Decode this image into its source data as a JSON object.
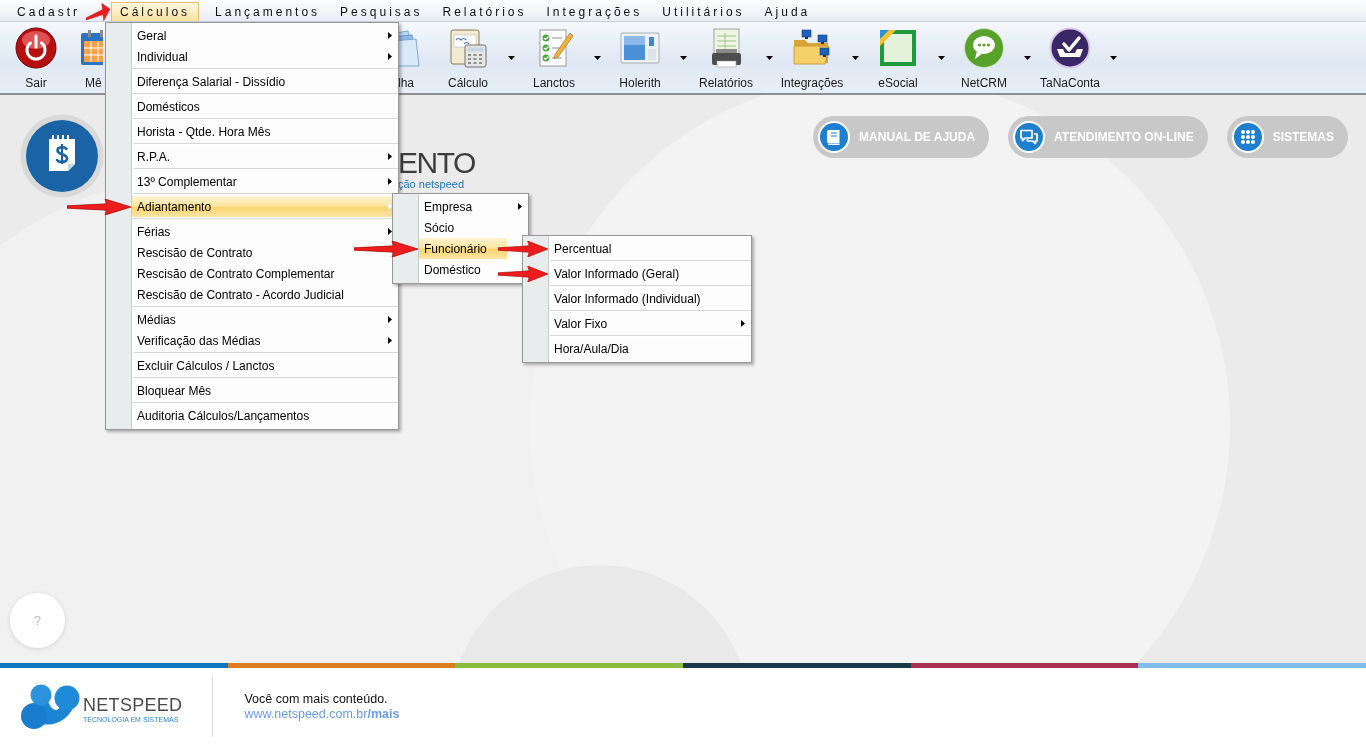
{
  "menu_bar": {
    "items": [
      {
        "label": "Cadastr",
        "selected": false,
        "pointed_at": false
      },
      {
        "label": "Cálculos",
        "selected": true,
        "pointed_at": true,
        "menu": {
          "sections": [
            [
              {
                "label": "Geral",
                "has_arrow": true,
                "selected": false,
                "pointed_at": false
              },
              {
                "label": "Individual",
                "has_arrow": true,
                "selected": false,
                "pointed_at": false
              }
            ],
            [
              {
                "label": "Diferença Salarial - Dissídio",
                "has_arrow": false,
                "selected": false,
                "pointed_at": false
              }
            ],
            [
              {
                "label": "Domésticos",
                "has_arrow": false,
                "selected": false,
                "pointed_at": false
              }
            ],
            [
              {
                "label": "Horista - Qtde. Hora Mês",
                "has_arrow": false,
                "selected": false,
                "pointed_at": false
              }
            ],
            [
              {
                "label": "R.P.A.",
                "has_arrow": true,
                "selected": false,
                "pointed_at": false
              }
            ],
            [
              {
                "label": "13º Complementar",
                "has_arrow": true,
                "selected": false,
                "pointed_at": false
              }
            ],
            [
              {
                "label": "Adiantamento",
                "has_arrow": true,
                "selected": true,
                "pointed_at": true,
                "submenu": {
                  "sections": [
                    [
                      {
                        "label": "Empresa",
                        "has_arrow": true,
                        "selected": false,
                        "pointed_at": false
                      },
                      {
                        "label": "Sócio",
                        "has_arrow": false,
                        "selected": false,
                        "pointed_at": false
                      },
                      {
                        "label": "Funcionário",
                        "has_arrow": false,
                        "selected": true,
                        "pointed_at": true,
                        "submenu": {
                          "sections": [
                            [
                              {
                                "label": "Percentual",
                                "has_arrow": false,
                                "selected": false,
                                "pointed_at": true
                              }
                            ],
                            [
                              {
                                "label": "Valor Informado (Geral)",
                                "has_arrow": false,
                                "selected": false,
                                "pointed_at": true
                              }
                            ],
                            [
                              {
                                "label": "Valor Informado (Individual)",
                                "has_arrow": false,
                                "selected": false,
                                "pointed_at": false
                              }
                            ],
                            [
                              {
                                "label": "Valor Fixo",
                                "has_arrow": true,
                                "selected": false,
                                "pointed_at": false
                              }
                            ],
                            [
                              {
                                "label": "Hora/Aula/Dia",
                                "has_arrow": false,
                                "selected": false,
                                "pointed_at": false
                              }
                            ]
                          ]
                        }
                      },
                      {
                        "label": "Doméstico",
                        "has_arrow": false,
                        "selected": false,
                        "pointed_at": false
                      }
                    ]
                  ]
                }
              }
            ],
            [
              {
                "label": "Férias",
                "has_arrow": true,
                "selected": false,
                "pointed_at": false
              },
              {
                "label": "Rescisão de Contrato",
                "has_arrow": false,
                "selected": false,
                "pointed_at": false
              },
              {
                "label": "Rescisão de Contrato Complementar",
                "has_arrow": false,
                "selected": false,
                "pointed_at": false
              },
              {
                "label": "Rescisão de Contrato - Acordo Judicial",
                "has_arrow": false,
                "selected": false,
                "pointed_at": false
              }
            ],
            [
              {
                "label": "Médias",
                "has_arrow": true,
                "selected": false,
                "pointed_at": false
              },
              {
                "label": "Verificação das Médias",
                "has_arrow": true,
                "selected": false,
                "pointed_at": false
              }
            ],
            [
              {
                "label": "Excluir Cálculos / Lanctos",
                "has_arrow": false,
                "selected": false,
                "pointed_at": false
              }
            ],
            [
              {
                "label": "Bloquear Mês",
                "has_arrow": false,
                "selected": false,
                "pointed_at": false
              }
            ],
            [
              {
                "label": "Auditoria Cálculos/Lançamentos",
                "has_arrow": false,
                "selected": false,
                "pointed_at": false
              }
            ]
          ]
        }
      },
      {
        "label": "Lançamentos",
        "selected": false,
        "pointed_at": false
      },
      {
        "label": "Pesquisas",
        "selected": false,
        "pointed_at": false
      },
      {
        "label": "Relatórios",
        "selected": false,
        "pointed_at": false
      },
      {
        "label": "Integrações",
        "selected": false,
        "pointed_at": false
      },
      {
        "label": "Utilitários",
        "selected": false,
        "pointed_at": false
      },
      {
        "label": "Ajuda",
        "selected": false,
        "pointed_at": false
      }
    ]
  },
  "toolbar": {
    "items": [
      {
        "label": "Sair",
        "kind": "power",
        "dropdown": false,
        "clipped_left": false,
        "clipped_right": false
      },
      {
        "label": "Mê",
        "kind": "calendar",
        "dropdown": false,
        "clipped_left": false,
        "clipped_right": true
      },
      {
        "label": "lha",
        "kind": "papers",
        "dropdown": false,
        "clipped_left": true,
        "clipped_right": false
      },
      {
        "label": "Cálculo",
        "kind": "calculator",
        "dropdown": true,
        "clipped_left": false,
        "clipped_right": false
      },
      {
        "label": "Lanctos",
        "kind": "checklist",
        "dropdown": true,
        "clipped_left": false,
        "clipped_right": false
      },
      {
        "label": "Holerith",
        "kind": "window",
        "dropdown": true,
        "clipped_left": false,
        "clipped_right": false
      },
      {
        "label": "Relatórios",
        "kind": "printer",
        "dropdown": true,
        "clipped_left": false,
        "clipped_right": false
      },
      {
        "label": "Integrações",
        "kind": "network-folder",
        "dropdown": true,
        "clipped_left": false,
        "clipped_right": false
      },
      {
        "label": "eSocial",
        "kind": "esocial",
        "dropdown": true,
        "clipped_left": false,
        "clipped_right": false
      },
      {
        "label": "NetCRM",
        "kind": "speech",
        "dropdown": true,
        "clipped_left": false,
        "clipped_right": false
      },
      {
        "label": "TaNaConta",
        "kind": "check-tray",
        "dropdown": true,
        "clipped_left": false,
        "clipped_right": false
      }
    ]
  },
  "page": {
    "title": "ENTO",
    "subtitle": "ção netspeed"
  },
  "header_buttons": [
    {
      "label": "MANUAL DE AJUDA",
      "kind": "book"
    },
    {
      "label": "ATENDIMENTO ON-LINE",
      "kind": "chat"
    },
    {
      "label": "SISTEMAS",
      "kind": "apps"
    }
  ],
  "help_button": {
    "label": "?"
  },
  "footer": {
    "brand": "NETSPEED",
    "tagline": "TECNOLOGIA EM SISTEMAS",
    "message": "Você com mais conteúdo.",
    "link": "www.netspeed.com.br**/mais**"
  }
}
